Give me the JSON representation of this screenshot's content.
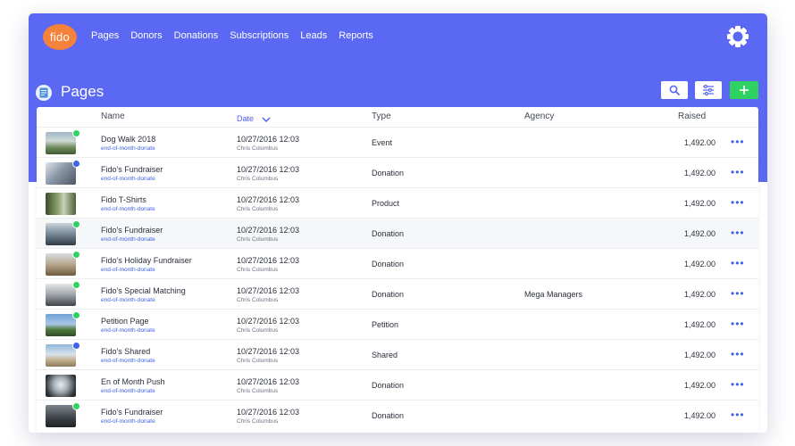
{
  "brand": {
    "logo_text": "fido",
    "colors": {
      "primary": "#5b68f3",
      "accent": "#f5823a",
      "add": "#2fd161",
      "link": "#3d63e6"
    }
  },
  "nav": {
    "items": [
      "Pages",
      "Donors",
      "Donations",
      "Subscriptions",
      "Leads",
      "Reports"
    ],
    "settings_icon": "gear-icon"
  },
  "page": {
    "title": "Pages",
    "icon": "document-icon"
  },
  "toolbar": {
    "search_icon": "search-icon",
    "filter_icon": "sliders-icon",
    "add_icon": "plus-icon"
  },
  "table": {
    "columns": {
      "name": "Name",
      "date": "Date",
      "type": "Type",
      "agency": "Agency",
      "raised": "Raised"
    },
    "sort": {
      "column": "Date",
      "direction": "desc"
    },
    "rows": [
      {
        "name": "Dog Walk 2018",
        "slug": "end-of-month-donate",
        "date": "10/27/2016 12:03",
        "author": "Chris Columbus",
        "type": "Event",
        "agency": "",
        "raised": "1,492.00",
        "status": "green"
      },
      {
        "name": "Fido's Fundraiser",
        "slug": "end-of-month-donate",
        "date": "10/27/2016 12:03",
        "author": "Chris Columbus",
        "type": "Donation",
        "agency": "",
        "raised": "1,492.00",
        "status": "blue"
      },
      {
        "name": "Fido T-Shirts",
        "slug": "end-of-month-donate",
        "date": "10/27/2016 12:03",
        "author": "Chris Columbus",
        "type": "Product",
        "agency": "",
        "raised": "1,492.00",
        "status": "none"
      },
      {
        "name": "Fido's Fundraiser",
        "slug": "end-of-month-donate",
        "date": "10/27/2016 12:03",
        "author": "Chris Columbus",
        "type": "Donation",
        "agency": "",
        "raised": "1,492.00",
        "status": "green"
      },
      {
        "name": "Fido's Holiday Fundraiser",
        "slug": "end-of-month-donate",
        "date": "10/27/2016 12:03",
        "author": "Chris Columbus",
        "type": "Donation",
        "agency": "",
        "raised": "1,492.00",
        "status": "green"
      },
      {
        "name": "Fido's Special Matching",
        "slug": "end-of-month-donate",
        "date": "10/27/2016 12:03",
        "author": "Chris Columbus",
        "type": "Donation",
        "agency": "Mega Managers",
        "raised": "1,492.00",
        "status": "green"
      },
      {
        "name": "Petition Page",
        "slug": "end-of-month-donate",
        "date": "10/27/2016 12:03",
        "author": "Chris Columbus",
        "type": "Petition",
        "agency": "",
        "raised": "1,492.00",
        "status": "green"
      },
      {
        "name": "Fido's Shared",
        "slug": "end-of-month-donate",
        "date": "10/27/2016 12:03",
        "author": "Chris Columbus",
        "type": "Shared",
        "agency": "",
        "raised": "1,492.00",
        "status": "blue"
      },
      {
        "name": "En of Month Push",
        "slug": "end-of-month-donate",
        "date": "10/27/2016 12:03",
        "author": "Chris Columbus",
        "type": "Donation",
        "agency": "",
        "raised": "1,492.00",
        "status": "none"
      },
      {
        "name": "Fido's Fundraiser",
        "slug": "end-of-month-donate",
        "date": "10/27/2016 12:03",
        "author": "Chris Columbus",
        "type": "Donation",
        "agency": "",
        "raised": "1,492.00",
        "status": "green"
      }
    ]
  }
}
